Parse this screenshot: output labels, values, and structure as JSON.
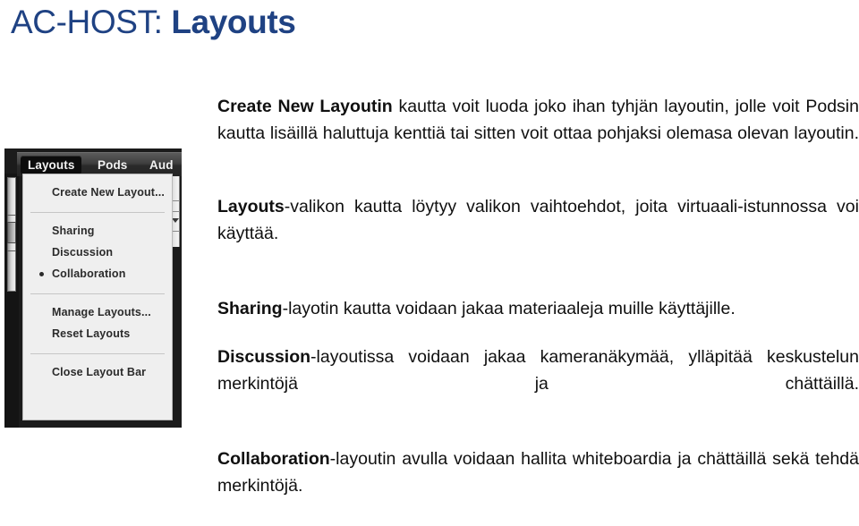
{
  "slide": {
    "title_prefix": "AC-HOST: ",
    "title_bold": "Layouts",
    "title_color": "#1F4283"
  },
  "screenshot": {
    "description": "Adobe Connect host menu bar with the Layouts dropdown open",
    "menubar": {
      "items": [
        {
          "label": "Layouts",
          "active": true
        },
        {
          "label": "Pods",
          "active": false
        },
        {
          "label": "Aud",
          "active": false
        }
      ]
    },
    "dropdown": {
      "groups": [
        {
          "items": [
            {
              "label": "Create New Layout...",
              "selected": false
            }
          ]
        },
        {
          "items": [
            {
              "label": "Sharing",
              "selected": false
            },
            {
              "label": "Discussion",
              "selected": false
            },
            {
              "label": "Collaboration",
              "selected": true
            }
          ]
        },
        {
          "items": [
            {
              "label": "Manage Layouts...",
              "selected": false
            },
            {
              "label": "Reset Layouts",
              "selected": false
            }
          ]
        },
        {
          "items": [
            {
              "label": "Close Layout Bar",
              "selected": false
            }
          ]
        }
      ]
    }
  },
  "body": {
    "paragraphs": [
      {
        "lead": "Create New Layoutin",
        "rest": " kautta voit luoda joko ihan tyhjän layoutin, jolle voit Podsin kautta  lisäillä haluttuja kenttiä tai sitten voit ottaa pohjaksi olemasa olevan layoutin."
      },
      {
        "lead": "Layouts",
        "rest": "-valikon kautta löytyy valikon vaihtoehdot, joita virtuaali-istunnossa voi käyttää."
      },
      {
        "lead": "Sharing",
        "rest": "-layotin kautta voidaan jakaa materiaaleja muille käyttäjille."
      },
      {
        "lead": "Discussion",
        "rest": "-layoutissa voidaan jakaa kameranäkymää, ylläpitää keskustelun merkintöjä ja chättäillä."
      },
      {
        "lead": "Collaboration",
        "rest": "-layoutin avulla voidaan hallita whiteboardia ja chättäillä sekä tehdä merkintöjä."
      }
    ]
  }
}
